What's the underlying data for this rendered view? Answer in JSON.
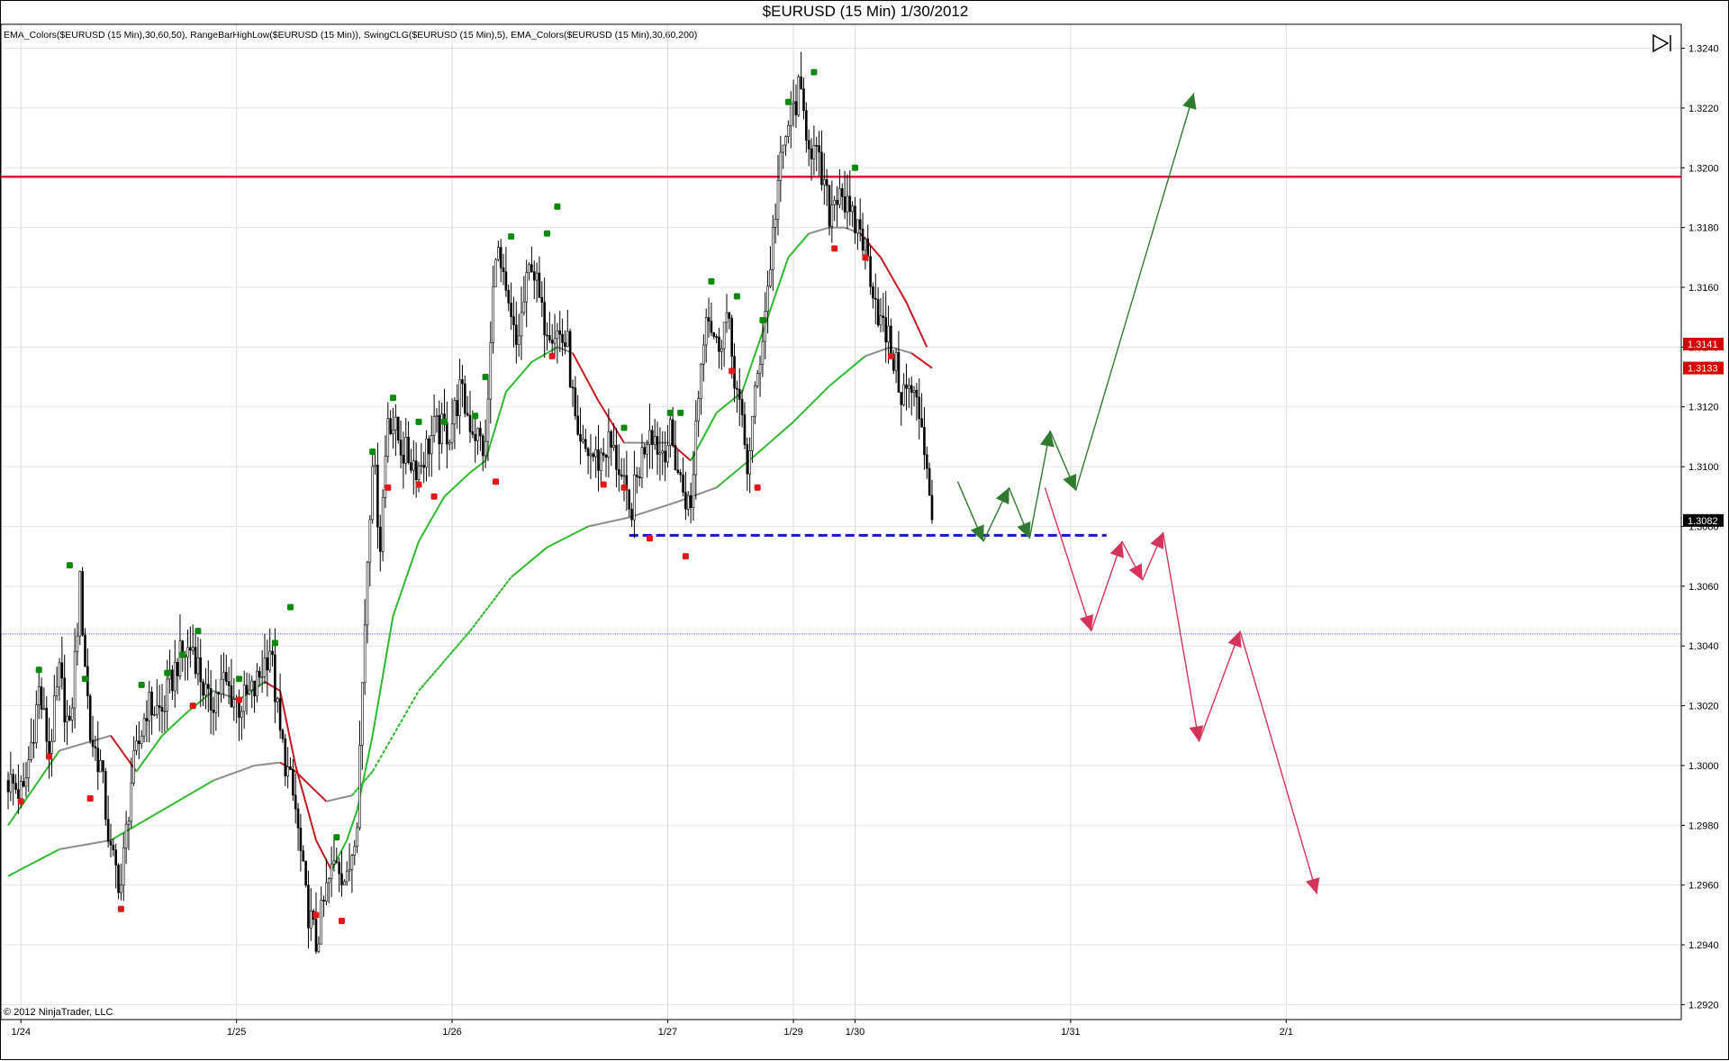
{
  "window": {
    "title": "$EURUSD (15 Min)  1/30/2012",
    "indicators": "EMA_Colors($EURUSD (15 Min),30,60,50), RangeBarHighLow($EURUSD (15 Min)), SwingCLG($EURUSD (15 Min),5), EMA_Colors($EURUSD (15 Min),30,60,200)",
    "copyright": "© 2012 NinjaTrader, LLC",
    "scroll_end_icon": "skip-to-end-icon"
  },
  "colors": {
    "bull_candle": "#ffffff",
    "bear_candle": "#000000",
    "ema_up": "#2db82d",
    "ema_down": "#c4161c",
    "ema_flat": "#8a8a8a",
    "resistance": "#d6163c",
    "support": "#1414d2",
    "midline": "#5a5ac8",
    "swing_high": "#0a8a0a",
    "swing_low": "#e01818",
    "bull_projection": "#2f7a2f",
    "bear_projection": "#d4335a"
  },
  "chart_data": {
    "type": "candlestick",
    "instrument": "$EURUSD",
    "interval": "15 Min",
    "ylim": [
      1.2915,
      1.3248
    ],
    "y_ticks": [
      "1.2920",
      "1.2940",
      "1.2960",
      "1.2980",
      "1.3000",
      "1.3020",
      "1.3040",
      "1.3060",
      "1.3080",
      "1.3100",
      "1.3120",
      "1.3140",
      "1.3160",
      "1.3180",
      "1.3200",
      "1.3220",
      "1.3240"
    ],
    "x_ticks": [
      {
        "label": "1/24",
        "bar": 5
      },
      {
        "label": "1/25",
        "bar": 89
      },
      {
        "label": "1/26",
        "bar": 173
      },
      {
        "label": "1/27",
        "bar": 257
      },
      {
        "label": "1/29",
        "bar": 306
      },
      {
        "label": "1/30",
        "bar": 330
      },
      {
        "label": "1/31",
        "bar": 414
      },
      {
        "label": "2/1",
        "bar": 498
      }
    ],
    "price_markers": [
      {
        "label": "1.3141",
        "value": 1.3141,
        "style": "red"
      },
      {
        "label": "1.3133",
        "value": 1.3133,
        "style": "red"
      },
      {
        "label": "1.3082",
        "value": 1.3082,
        "style": "black"
      }
    ],
    "horizontal_lines": [
      {
        "name": "resistance",
        "value": 1.3197
      },
      {
        "name": "midline",
        "value": 1.3044
      }
    ],
    "support_line": {
      "value": 1.3077,
      "from_bar": 242,
      "to_bar": 428
    },
    "price_path": [
      [
        0,
        1.2995
      ],
      [
        6,
        1.299
      ],
      [
        12,
        1.3025
      ],
      [
        16,
        1.3005
      ],
      [
        20,
        1.303
      ],
      [
        24,
        1.301
      ],
      [
        28,
        1.306
      ],
      [
        32,
        1.301
      ],
      [
        36,
        1.3
      ],
      [
        40,
        1.297
      ],
      [
        44,
        1.296
      ],
      [
        48,
        1.2995
      ],
      [
        54,
        1.302
      ],
      [
        60,
        1.3018
      ],
      [
        66,
        1.3035
      ],
      [
        72,
        1.304
      ],
      [
        78,
        1.302
      ],
      [
        84,
        1.3028
      ],
      [
        90,
        1.302
      ],
      [
        96,
        1.3025
      ],
      [
        102,
        1.304
      ],
      [
        106,
        1.301
      ],
      [
        112,
        1.2985
      ],
      [
        116,
        1.2955
      ],
      [
        120,
        1.294
      ],
      [
        124,
        1.2958
      ],
      [
        128,
        1.297
      ],
      [
        132,
        1.296
      ],
      [
        136,
        1.2985
      ],
      [
        140,
        1.307
      ],
      [
        142,
        1.3105
      ],
      [
        145,
        1.3075
      ],
      [
        148,
        1.3118
      ],
      [
        154,
        1.3105
      ],
      [
        160,
        1.31
      ],
      [
        166,
        1.3112
      ],
      [
        172,
        1.3112
      ],
      [
        176,
        1.3125
      ],
      [
        180,
        1.3115
      ],
      [
        186,
        1.3105
      ],
      [
        190,
        1.3175
      ],
      [
        194,
        1.3155
      ],
      [
        198,
        1.314
      ],
      [
        204,
        1.317
      ],
      [
        208,
        1.315
      ],
      [
        214,
        1.3145
      ],
      [
        218,
        1.314
      ],
      [
        222,
        1.3105
      ],
      [
        226,
        1.3105
      ],
      [
        230,
        1.3102
      ],
      [
        234,
        1.3108
      ],
      [
        238,
        1.31
      ],
      [
        242,
        1.3083
      ],
      [
        246,
        1.31
      ],
      [
        250,
        1.3115
      ],
      [
        254,
        1.3105
      ],
      [
        258,
        1.311
      ],
      [
        262,
        1.3095
      ],
      [
        266,
        1.3085
      ],
      [
        268,
        1.3115
      ],
      [
        272,
        1.3155
      ],
      [
        276,
        1.314
      ],
      [
        280,
        1.315
      ],
      [
        284,
        1.3125
      ],
      [
        288,
        1.31
      ],
      [
        292,
        1.313
      ],
      [
        296,
        1.316
      ],
      [
        300,
        1.3195
      ],
      [
        304,
        1.3215
      ],
      [
        308,
        1.3225
      ],
      [
        312,
        1.321
      ],
      [
        316,
        1.32
      ],
      [
        320,
        1.3185
      ],
      [
        324,
        1.3195
      ],
      [
        328,
        1.3182
      ],
      [
        332,
        1.318
      ],
      [
        336,
        1.3165
      ],
      [
        340,
        1.3148
      ],
      [
        344,
        1.314
      ],
      [
        348,
        1.3125
      ],
      [
        352,
        1.3125
      ],
      [
        356,
        1.3115
      ],
      [
        360,
        1.3085
      ]
    ],
    "ema_50": [
      [
        0,
        1.298
      ],
      [
        20,
        1.3005
      ],
      [
        40,
        1.301
      ],
      [
        50,
        1.2998
      ],
      [
        60,
        1.301
      ],
      [
        70,
        1.3018
      ],
      [
        80,
        1.3025
      ],
      [
        90,
        1.3022
      ],
      [
        100,
        1.3028
      ],
      [
        106,
        1.3025
      ],
      [
        112,
        1.3
      ],
      [
        120,
        1.2975
      ],
      [
        126,
        1.2965
      ],
      [
        132,
        1.2975
      ],
      [
        136,
        1.2985
      ],
      [
        142,
        1.301
      ],
      [
        150,
        1.305
      ],
      [
        160,
        1.3075
      ],
      [
        170,
        1.309
      ],
      [
        180,
        1.3098
      ],
      [
        186,
        1.3102
      ],
      [
        194,
        1.3125
      ],
      [
        204,
        1.3135
      ],
      [
        214,
        1.314
      ],
      [
        220,
        1.3138
      ],
      [
        230,
        1.3122
      ],
      [
        240,
        1.3108
      ],
      [
        250,
        1.3108
      ],
      [
        258,
        1.3108
      ],
      [
        266,
        1.3102
      ],
      [
        276,
        1.3118
      ],
      [
        286,
        1.3125
      ],
      [
        294,
        1.3145
      ],
      [
        304,
        1.317
      ],
      [
        312,
        1.3178
      ],
      [
        320,
        1.318
      ],
      [
        326,
        1.318
      ],
      [
        332,
        1.3178
      ],
      [
        340,
        1.317
      ],
      [
        350,
        1.3155
      ],
      [
        358,
        1.314
      ]
    ],
    "ema_200": [
      [
        0,
        1.2963
      ],
      [
        20,
        1.2972
      ],
      [
        40,
        1.2975
      ],
      [
        60,
        1.2985
      ],
      [
        80,
        1.2995
      ],
      [
        96,
        1.3
      ],
      [
        106,
        1.3001
      ],
      [
        112,
        1.2998
      ],
      [
        124,
        1.2988
      ],
      [
        134,
        1.299
      ],
      [
        142,
        1.2998
      ],
      [
        160,
        1.3025
      ],
      [
        180,
        1.3045
      ],
      [
        196,
        1.3063
      ],
      [
        210,
        1.3073
      ],
      [
        226,
        1.308
      ],
      [
        242,
        1.3083
      ],
      [
        260,
        1.3088
      ],
      [
        276,
        1.3093
      ],
      [
        290,
        1.3103
      ],
      [
        306,
        1.3115
      ],
      [
        320,
        1.3127
      ],
      [
        334,
        1.3137
      ],
      [
        344,
        1.314
      ],
      [
        352,
        1.3138
      ],
      [
        360,
        1.3133
      ]
    ],
    "swing_highs": [
      [
        12,
        1.3032
      ],
      [
        24,
        1.3067
      ],
      [
        30,
        1.3029
      ],
      [
        52,
        1.3027
      ],
      [
        62,
        1.3031
      ],
      [
        68,
        1.3037
      ],
      [
        74,
        1.3045
      ],
      [
        90,
        1.3029
      ],
      [
        104,
        1.3041
      ],
      [
        110,
        1.3053
      ],
      [
        128,
        1.2976
      ],
      [
        142,
        1.3105
      ],
      [
        150,
        1.3123
      ],
      [
        160,
        1.3115
      ],
      [
        170,
        1.3115
      ],
      [
        182,
        1.3117
      ],
      [
        186,
        1.313
      ],
      [
        196,
        1.3177
      ],
      [
        210,
        1.3178
      ],
      [
        214,
        1.3187
      ],
      [
        240,
        1.3113
      ],
      [
        258,
        1.3118
      ],
      [
        262,
        1.3118
      ],
      [
        274,
        1.3162
      ],
      [
        284,
        1.3157
      ],
      [
        294,
        1.3149
      ],
      [
        304,
        1.3222
      ],
      [
        314,
        1.3232
      ],
      [
        330,
        1.32
      ]
    ],
    "swing_lows": [
      [
        5,
        1.2988
      ],
      [
        16,
        1.3003
      ],
      [
        32,
        1.2989
      ],
      [
        44,
        1.2952
      ],
      [
        72,
        1.302
      ],
      [
        90,
        1.3022
      ],
      [
        120,
        1.295
      ],
      [
        130,
        1.2948
      ],
      [
        148,
        1.3093
      ],
      [
        160,
        1.3094
      ],
      [
        166,
        1.309
      ],
      [
        190,
        1.3095
      ],
      [
        212,
        1.3137
      ],
      [
        232,
        1.3094
      ],
      [
        240,
        1.3093
      ],
      [
        250,
        1.3076
      ],
      [
        264,
        1.307
      ],
      [
        282,
        1.3132
      ],
      [
        292,
        1.3093
      ],
      [
        322,
        1.3173
      ],
      [
        334,
        1.317
      ],
      [
        344,
        1.3137
      ]
    ],
    "bull_projection": [
      [
        370,
        1.3095
      ],
      [
        380,
        1.3075
      ],
      [
        390,
        1.3093
      ],
      [
        398,
        1.3076
      ],
      [
        406,
        1.3112
      ],
      [
        416,
        1.3092
      ],
      [
        462,
        1.3225
      ]
    ],
    "bear_projection": [
      [
        404,
        1.3093
      ],
      [
        422,
        1.3045
      ],
      [
        434,
        1.3075
      ],
      [
        442,
        1.3062
      ],
      [
        450,
        1.3078
      ],
      [
        464,
        1.3008
      ],
      [
        480,
        1.3045
      ],
      [
        510,
        1.2957
      ]
    ]
  }
}
